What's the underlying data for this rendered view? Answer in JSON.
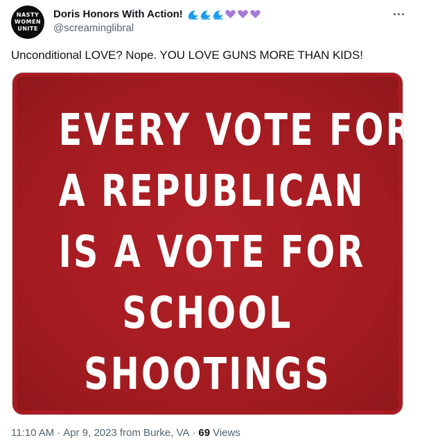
{
  "author": {
    "avatar_lines": [
      "NASTY",
      "WOMEN",
      "UNITE"
    ],
    "display_name": "Doris Honors With Action!",
    "handle": "@screaminglibral",
    "name_emojis": [
      "wave-icon",
      "wave-icon",
      "wave-icon",
      "purple-heart-icon",
      "purple-heart-icon",
      "purple-heart-icon"
    ]
  },
  "tweet": {
    "text": "Unconditional LOVE? Nope. YOU LOVE GUNS MORE THAN KIDS!"
  },
  "image": {
    "lines": [
      "EVERY VOTE FOR",
      "A REPUBLICAN",
      "IS A VOTE FOR",
      "SCHOOL",
      "SHOOTINGS"
    ],
    "background_color": "#a81c21"
  },
  "meta": {
    "time": "11:10 AM",
    "separator": "·",
    "date": "Apr 9, 2023",
    "location": "from Burke, VA",
    "views_count": "69",
    "views_label": "Views"
  },
  "colors": {
    "wave": "#1d9bf0",
    "heart": "#a67ad8",
    "secondary_text": "#536471"
  }
}
